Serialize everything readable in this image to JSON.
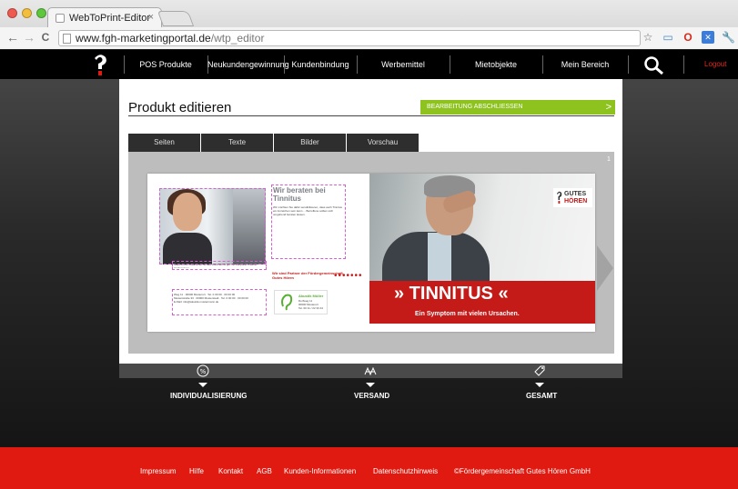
{
  "browser": {
    "tab_title": "WebToPrint-Editor",
    "tab_close": "×",
    "url_host": "www.fgh-marketingportal.de",
    "url_path": "/wtp_editor",
    "back": "←",
    "forward": "→",
    "reload": "C"
  },
  "nav": {
    "items": [
      "POS Produkte",
      "Neukundengewinnung",
      "Kundenbindung",
      "Werbemittel",
      "Mietobjekte",
      "Mein Bereich"
    ],
    "logout": "Logout"
  },
  "editor": {
    "title": "Produkt editieren",
    "finish_button": "BEARBEITUNG ABSCHLIESSEN",
    "tabs": [
      "Seiten",
      "Texte",
      "Bilder",
      "Vorschau"
    ],
    "page_number": "1"
  },
  "document": {
    "heading": "Wir beraten bei Tinnitus",
    "body_text": "Wir möchten Sie dafür sensibilisieren, dass auch Tinnitus ein Anzeichen sein kann ... Betroffene sollten sich umgehend beraten lassen.",
    "member_note": "Wir sind Partner der Fördergemeinschaft Gutes Hören",
    "caption": "Stets mit dir zusammen ist das Hörerlebnis gut. Ab Zeitpunkt unserer Hörberatung.",
    "contacts": "Weg 11 · 00000 Musterort · Tel. 0 00 00 · 00 00 00\nMusterstraße 33 · 00000 Musterstadt · Tel. 0 00 00 · 00 00 00\nE-Mail: info@akustik-mustermann.de",
    "shop_name": "Akustik Müller",
    "shop_address": "Dorfweg 11\n00000 Musterort\nTel. 00 11 / 22 33 44",
    "brand_line1": "GUTES",
    "brand_line2": "HÖREN",
    "banner_title": "» TINNITUS «",
    "banner_sub": "Ein Symptom mit vielen Ursachen."
  },
  "steps": [
    {
      "label": "INDIVIDUALISIERUNG",
      "icon": "percent-icon"
    },
    {
      "label": "VERSAND",
      "icon": "delivery-icon"
    },
    {
      "label": "GESAMT",
      "icon": "tag-icon"
    }
  ],
  "footer": {
    "links": [
      "Impressum",
      "Hilfe",
      "Kontakt",
      "AGB",
      "Kunden-Informationen",
      "Datenschutzhinweis",
      "©Fördergemeinschaft Gutes Hören GmbH"
    ]
  },
  "colors": {
    "accent_green": "#8dc21f",
    "brand_red": "#e01a10",
    "nav_black": "#000000"
  }
}
